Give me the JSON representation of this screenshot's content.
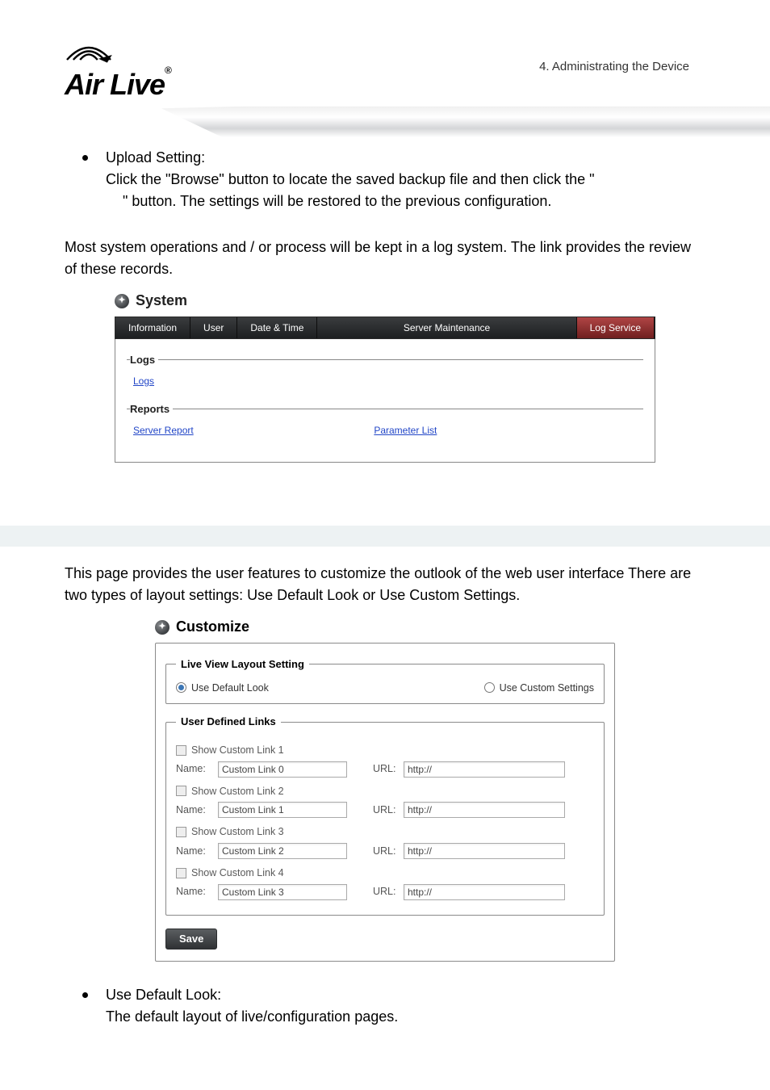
{
  "breadcrumb": "4.  Administrating  the  Device",
  "logo": {
    "brand": "Air Live",
    "reg": "®"
  },
  "body": {
    "upload_heading": "Upload Setting:",
    "upload_line1": "Click the \"Browse\" button to locate the saved backup file and then click the \"",
    "upload_line2": "\" button. The settings will be restored to the previous configuration.",
    "log_para": "Most system operations and / or process will be kept in a log system.    The link provides the review of these records.",
    "custom_para": "This page provides the user features to customize the outlook of the web user interface There are two types of layout settings: Use Default Look or Use Custom Settings.",
    "use_default_heading": "Use Default Look:",
    "use_default_text": "The default layout of live/configuration pages."
  },
  "system_panel": {
    "title": "System",
    "tabs": {
      "information": "Information",
      "user": "User",
      "date_time": "Date & Time",
      "server_maint": "Server Maintenance",
      "log_service": "Log Service"
    },
    "logs_legend": "Logs",
    "logs_link": "Logs",
    "reports_legend": "Reports",
    "server_report_link": "Server Report",
    "parameter_list_link": "Parameter List"
  },
  "customize_panel": {
    "title": "Customize",
    "live_view_legend": "Live View Layout Setting",
    "use_default_label": "Use Default Look",
    "use_custom_label": "Use Custom Settings",
    "user_links_legend": "User Defined Links",
    "rows": [
      {
        "show": "Show Custom Link  1",
        "name_lbl": "Name:",
        "name": "Custom Link 0",
        "url_lbl": "URL:",
        "url": "http://"
      },
      {
        "show": "Show Custom Link  2",
        "name_lbl": "Name:",
        "name": "Custom Link 1",
        "url_lbl": "URL:",
        "url": "http://"
      },
      {
        "show": "Show Custom Link  3",
        "name_lbl": "Name:",
        "name": "Custom Link 2",
        "url_lbl": "URL:",
        "url": "http://"
      },
      {
        "show": "Show Custom Link  4",
        "name_lbl": "Name:",
        "name": "Custom Link 3",
        "url_lbl": "URL:",
        "url": "http://"
      }
    ],
    "save": "Save"
  }
}
